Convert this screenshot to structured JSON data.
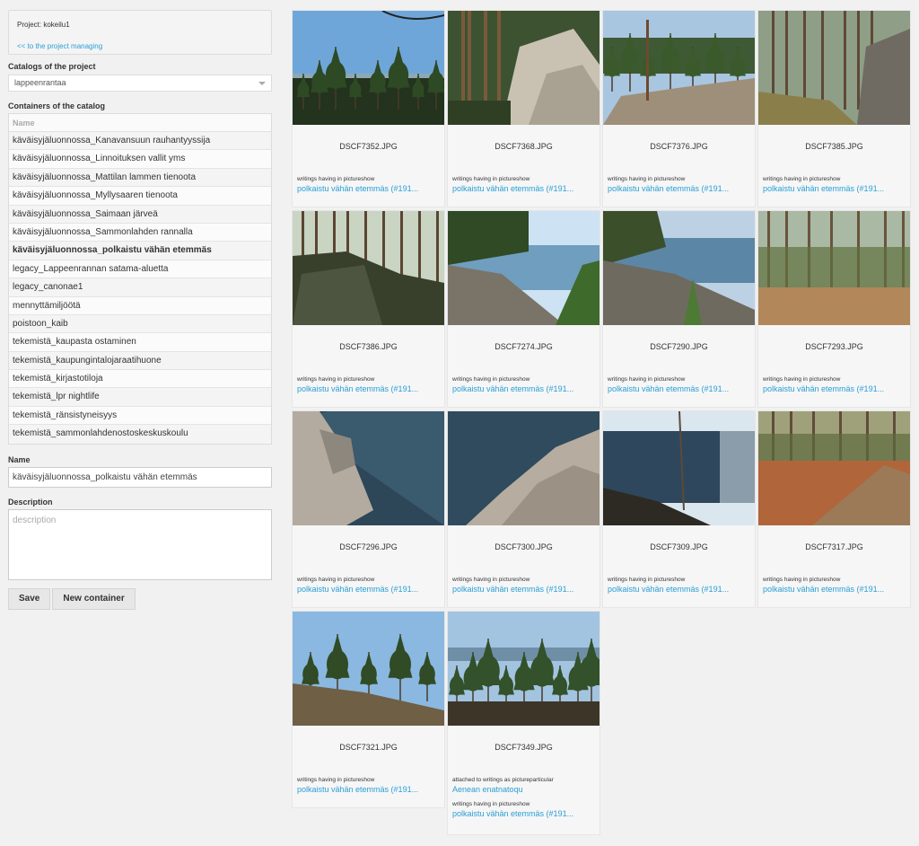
{
  "project": {
    "label": "Project: kokeilu1",
    "link": "<< to the project managing"
  },
  "catalogs": {
    "label": "Catalogs of the project",
    "selected": "lappeenrantaa"
  },
  "containers": {
    "label": "Containers of the catalog",
    "header": "Name",
    "items": [
      "käväisyjäluonnossa_Kanavansuun rauhantyyssija",
      "käväisyjäluonnossa_Linnoituksen vallit yms",
      "käväisyjäluonnossa_Mattilan lammen tienoota",
      "käväisyjäluonnossa_Myllysaaren tienoota",
      "käväisyjäluonnossa_Saimaan järveä",
      "käväisyjäluonnossa_Sammonlahden rannalla",
      "käväisyjäluonnossa_polkaistu vähän etemmäs",
      "legacy_Lappeenrannan satama-aluetta",
      "legacy_canonae1",
      "mennyttämiljöötä",
      "poistoon_kaib",
      "tekemistä_kaupasta ostaminen",
      "tekemistä_kaupungintalojaraatihuone",
      "tekemistä_kirjastotiloja",
      "tekemistä_lpr nightlife",
      "tekemistä_ränsistyneisyys",
      "tekemistä_sammonlahdenostoskeskuskoulu"
    ],
    "selected_index": 6
  },
  "form": {
    "name_label": "Name",
    "name_value": "käväisyjäluonnossa_polkaistu vähän etemmäs",
    "description_label": "Description",
    "description_placeholder": "description",
    "save_label": "Save",
    "new_label": "New container"
  },
  "photos": [
    {
      "file": "DSCF7352.JPG",
      "note": "writings having in pictureshow",
      "link": "polkaistu vähän etemmäs (#191...",
      "scene": "forest-sky"
    },
    {
      "file": "DSCF7368.JPG",
      "note": "writings having in pictureshow",
      "link": "polkaistu vähän etemmäs (#191...",
      "scene": "rock-forest"
    },
    {
      "file": "DSCF7376.JPG",
      "note": "writings having in pictureshow",
      "link": "polkaistu vähän etemmäs (#191...",
      "scene": "forest-lake-rock"
    },
    {
      "file": "DSCF7385.JPG",
      "note": "writings having in pictureshow",
      "link": "polkaistu vähän etemmäs (#191...",
      "scene": "forest-path"
    },
    {
      "file": "DSCF7386.JPG",
      "note": "writings having in pictureshow",
      "link": "polkaistu vähän etemmäs (#191...",
      "scene": "cliff-forest"
    },
    {
      "file": "DSCF7274.JPG",
      "note": "writings having in pictureshow",
      "link": "polkaistu vähän etemmäs (#191...",
      "scene": "shore-lake"
    },
    {
      "file": "DSCF7290.JPG",
      "note": "writings having in pictureshow",
      "link": "polkaistu vähän etemmäs (#191...",
      "scene": "shore-lake2"
    },
    {
      "file": "DSCF7293.JPG",
      "note": "writings having in pictureshow",
      "link": "polkaistu vähän etemmäs (#191...",
      "scene": "autumn-forest"
    },
    {
      "file": "DSCF7296.JPG",
      "note": "writings having in pictureshow",
      "link": "polkaistu vähän etemmäs (#191...",
      "scene": "rock-water"
    },
    {
      "file": "DSCF7300.JPG",
      "note": "writings having in pictureshow",
      "link": "polkaistu vähän etemmäs (#191...",
      "scene": "rock-water2"
    },
    {
      "file": "DSCF7309.JPG",
      "note": "writings having in pictureshow",
      "link": "polkaistu vähän etemmäs (#191...",
      "scene": "lake-sun"
    },
    {
      "file": "DSCF7317.JPG",
      "note": "writings having in pictureshow",
      "link": "polkaistu vähän etemmäs (#191...",
      "scene": "autumn-ferns"
    },
    {
      "file": "DSCF7321.JPG",
      "note": "writings having in pictureshow",
      "link": "polkaistu vähän etemmäs (#191...",
      "scene": "pine-rock"
    },
    {
      "file": "DSCF7349.JPG",
      "extra_note": "attached to writings as pictureparticular",
      "extra_link": "Aenean enatnatoqu",
      "note": "writings having in pictureshow",
      "link": "polkaistu vähän etemmäs (#191...",
      "scene": "forest-lake-view"
    }
  ]
}
